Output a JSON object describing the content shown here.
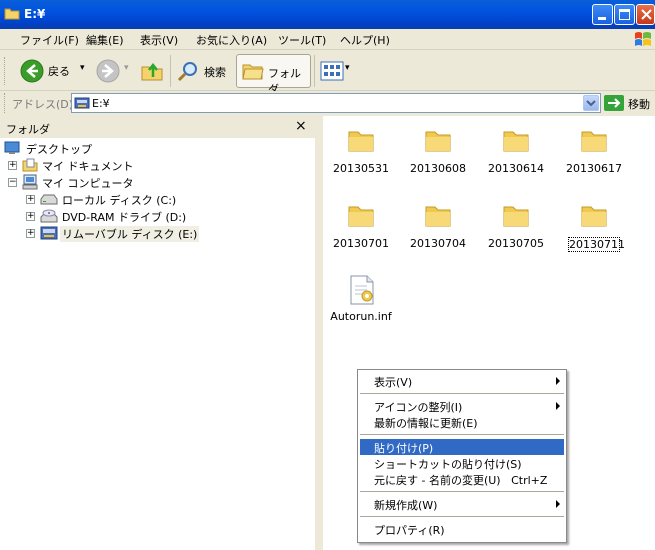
{
  "window": {
    "title": "E:¥"
  },
  "menubar": {
    "items": [
      "ファイル(F)",
      "編集(E)",
      "表示(V)",
      "お気に入り(A)",
      "ツール(T)",
      "ヘルプ(H)"
    ]
  },
  "toolbar": {
    "back_label": "戻る",
    "search_label": "検索",
    "folders_label": "フォルダ"
  },
  "address": {
    "label": "アドレス(D)",
    "value": "E:¥",
    "go_label": "移動"
  },
  "folder_pane": {
    "title": "フォルダ",
    "close": "×",
    "tree": [
      {
        "label": "デスクトップ",
        "icon": "desktop-icon",
        "expander": ""
      },
      {
        "label": "マイ ドキュメント",
        "icon": "my-documents-icon",
        "expander": "+"
      },
      {
        "label": "マイ コンピュータ",
        "icon": "my-computer-icon",
        "expander": "−"
      },
      {
        "label": "ローカル ディスク (C:)",
        "icon": "hard-disk-icon",
        "expander": "+"
      },
      {
        "label": "DVD-RAM ドライブ (D:)",
        "icon": "dvd-drive-icon",
        "expander": "+"
      },
      {
        "label": "リムーバブル ディスク (E:)",
        "icon": "removable-disk-icon",
        "expander": "+"
      }
    ]
  },
  "files": [
    {
      "name": "20130531",
      "type": "folder"
    },
    {
      "name": "20130608",
      "type": "folder"
    },
    {
      "name": "20130614",
      "type": "folder"
    },
    {
      "name": "20130617",
      "type": "folder"
    },
    {
      "name": "20130701",
      "type": "folder"
    },
    {
      "name": "20130704",
      "type": "folder"
    },
    {
      "name": "20130705",
      "type": "folder"
    },
    {
      "name": "20130711",
      "type": "folder"
    },
    {
      "name": "Autorun.inf",
      "type": "file"
    }
  ],
  "context_menu": {
    "items": [
      {
        "label": "表示(V)",
        "submenu": true
      },
      {
        "label": "アイコンの整列(I)",
        "submenu": true
      },
      {
        "label": "最新の情報に更新(E)",
        "submenu": false
      },
      {
        "label": "貼り付け(P)",
        "submenu": false,
        "highlighted": true
      },
      {
        "label": "ショートカットの貼り付け(S)",
        "submenu": false
      },
      {
        "label": "元に戻す - 名前の変更(U)   Ctrl+Z",
        "submenu": false
      },
      {
        "label": "新規作成(W)",
        "submenu": true
      },
      {
        "label": "プロパティ(R)",
        "submenu": false
      }
    ]
  },
  "colors": {
    "titlebar": "#0053e0",
    "highlight": "#316ac5",
    "folder": "#f5d76e"
  }
}
